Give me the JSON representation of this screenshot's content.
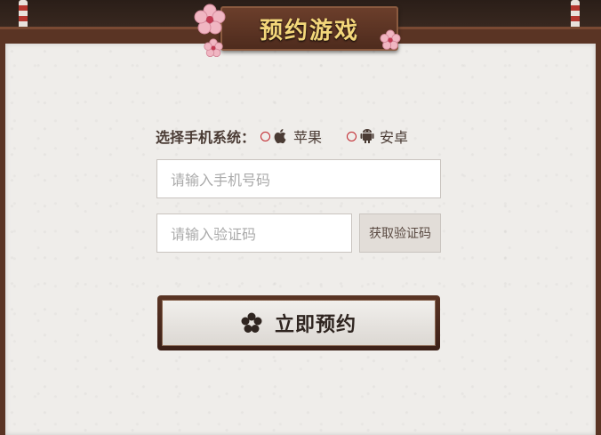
{
  "dialog": {
    "title": "预约游戏"
  },
  "os_select": {
    "label": "选择手机系统：",
    "options": [
      {
        "name": "苹果",
        "icon": "apple-icon",
        "selected": false
      },
      {
        "name": "安卓",
        "icon": "android-icon",
        "selected": false
      }
    ]
  },
  "phone_input": {
    "placeholder": "请输入手机号码",
    "value": ""
  },
  "code_input": {
    "placeholder": "请输入验证码",
    "value": ""
  },
  "get_code_button": {
    "label": "获取验证码"
  },
  "submit_button": {
    "label": "立即预约",
    "icon": "blossom-icon"
  },
  "colors": {
    "accent_red": "#c0232a",
    "title_gold": "#f3d67a",
    "frame_brown": "#5a3424"
  }
}
